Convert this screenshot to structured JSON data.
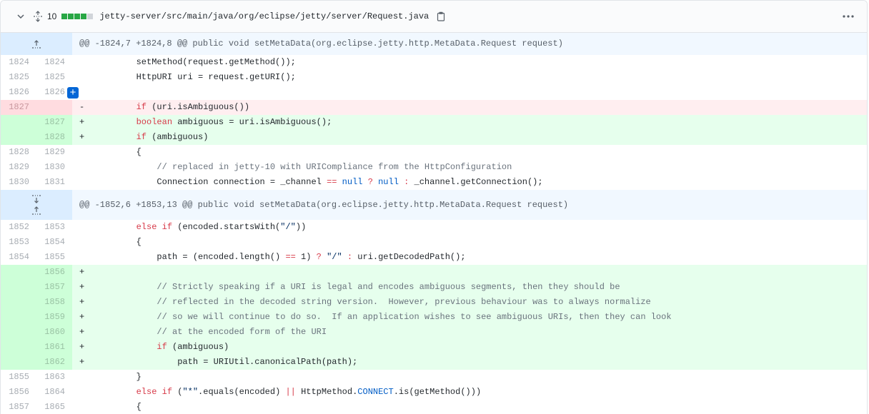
{
  "file": {
    "changes": "10",
    "path": "jetty-server/src/main/java/org/eclipse/jetty/server/Request.java",
    "diffstat": [
      "#28a745",
      "#28a745",
      "#28a745",
      "#28a745",
      "#d1d5da"
    ]
  },
  "colors": {
    "deletion_bg": "#ffeef0",
    "addition_bg": "#e6ffed",
    "hunk_bg": "#f1f8ff",
    "accent": "#0366d6"
  },
  "hunks": [
    {
      "header": "@@ -1824,7 +1824,8 @@ public void setMetaData(org.eclipse.jetty.http.MetaData.Request request)"
    },
    {
      "header": "@@ -1852,6 +1853,13 @@ public void setMetaData(org.eclipse.jetty.http.MetaData.Request request)"
    }
  ],
  "lines": [
    {
      "old": "1824",
      "new": "1824",
      "sign": "",
      "text": "        setMethod(request.getMethod());"
    },
    {
      "old": "1825",
      "new": "1825",
      "sign": "",
      "text": "        HttpURI uri = request.getURI();"
    },
    {
      "old": "1826",
      "new": "1826",
      "sign": "",
      "text": ""
    },
    {
      "old": "1827",
      "new": "",
      "sign": "-",
      "text": "        if (uri.isAmbiguous())"
    },
    {
      "old": "",
      "new": "1827",
      "sign": "+",
      "text": "        boolean ambiguous = uri.isAmbiguous();"
    },
    {
      "old": "",
      "new": "1828",
      "sign": "+",
      "text": "        if (ambiguous)"
    },
    {
      "old": "1828",
      "new": "1829",
      "sign": "",
      "text": "        {"
    },
    {
      "old": "1829",
      "new": "1830",
      "sign": "",
      "text": "            // replaced in jetty-10 with URICompliance from the HttpConfiguration"
    },
    {
      "old": "1830",
      "new": "1831",
      "sign": "",
      "text": "            Connection connection = _channel == null ? null : _channel.getConnection();"
    },
    {
      "old": "1852",
      "new": "1853",
      "sign": "",
      "text": "        else if (encoded.startsWith(\"/\"))"
    },
    {
      "old": "1853",
      "new": "1854",
      "sign": "",
      "text": "        {"
    },
    {
      "old": "1854",
      "new": "1855",
      "sign": "",
      "text": "            path = (encoded.length() == 1) ? \"/\" : uri.getDecodedPath();"
    },
    {
      "old": "",
      "new": "1856",
      "sign": "+",
      "text": ""
    },
    {
      "old": "",
      "new": "1857",
      "sign": "+",
      "text": "            // Strictly speaking if a URI is legal and encodes ambiguous segments, then they should be"
    },
    {
      "old": "",
      "new": "1858",
      "sign": "+",
      "text": "            // reflected in the decoded string version.  However, previous behaviour was to always normalize"
    },
    {
      "old": "",
      "new": "1859",
      "sign": "+",
      "text": "            // so we will continue to do so.  If an application wishes to see ambiguous URIs, then they can look"
    },
    {
      "old": "",
      "new": "1860",
      "sign": "+",
      "text": "            // at the encoded form of the URI"
    },
    {
      "old": "",
      "new": "1861",
      "sign": "+",
      "text": "            if (ambiguous)"
    },
    {
      "old": "",
      "new": "1862",
      "sign": "+",
      "text": "                path = URIUtil.canonicalPath(path);"
    },
    {
      "old": "1855",
      "new": "1863",
      "sign": "",
      "text": "        }"
    },
    {
      "old": "1856",
      "new": "1864",
      "sign": "",
      "text": "        else if (\"*\".equals(encoded) || HttpMethod.CONNECT.is(getMethod()))"
    },
    {
      "old": "1857",
      "new": "1865",
      "sign": "",
      "text": "        {"
    }
  ]
}
